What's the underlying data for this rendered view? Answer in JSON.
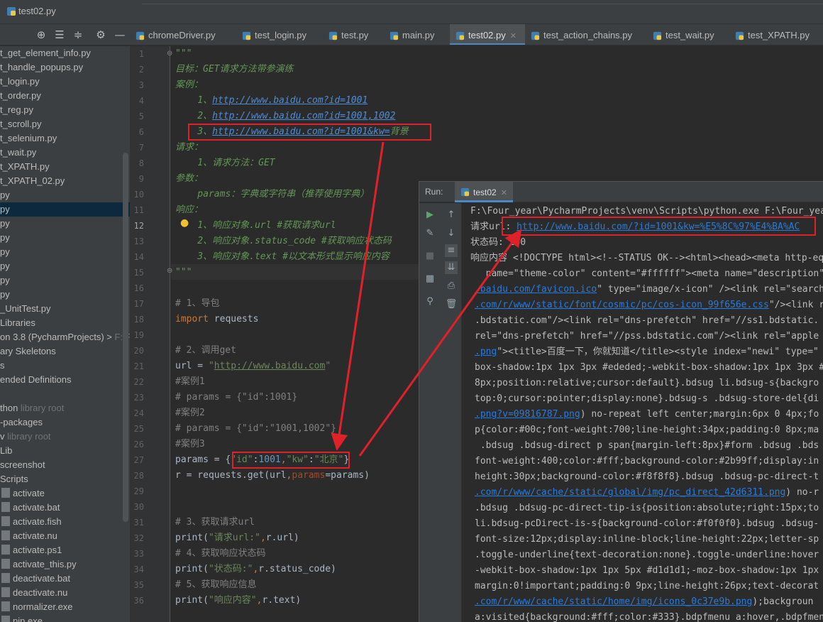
{
  "window": {
    "file_title": "test02.py"
  },
  "tabs": [
    {
      "label": "chromeDriver.py",
      "active": false
    },
    {
      "label": "test_login.py",
      "active": false
    },
    {
      "label": "test.py",
      "active": false
    },
    {
      "label": "main.py",
      "active": false
    },
    {
      "label": "test02.py",
      "active": true
    },
    {
      "label": "test_action_chains.py",
      "active": false
    },
    {
      "label": "test_wait.py",
      "active": false
    },
    {
      "label": "test_XPATH.py",
      "active": false
    }
  ],
  "project_tree": [
    {
      "label": "t_get_element_info.py",
      "muted": ""
    },
    {
      "label": "t_handle_popups.py",
      "muted": ""
    },
    {
      "label": "t_login.py",
      "muted": ""
    },
    {
      "label": "t_order.py",
      "muted": ""
    },
    {
      "label": "t_reg.py",
      "muted": ""
    },
    {
      "label": "t_scroll.py",
      "muted": ""
    },
    {
      "label": "t_selenium.py",
      "muted": ""
    },
    {
      "label": "t_wait.py",
      "muted": ""
    },
    {
      "label": "t_XPATH.py",
      "muted": ""
    },
    {
      "label": "t_XPATH_02.py",
      "muted": ""
    },
    {
      "label": "py",
      "muted": ""
    },
    {
      "label": "py",
      "muted": "",
      "selected": true
    },
    {
      "label": "py",
      "muted": ""
    },
    {
      "label": "py",
      "muted": ""
    },
    {
      "label": "py",
      "muted": ""
    },
    {
      "label": "py",
      "muted": ""
    },
    {
      "label": "py",
      "muted": ""
    },
    {
      "label": "py",
      "muted": ""
    },
    {
      "label": "_UnitTest.py",
      "muted": ""
    },
    {
      "label": "Libraries",
      "muted": ""
    },
    {
      "label": "on 3.8 (PycharmProjects)  > ",
      "muted": "F:\\F"
    },
    {
      "label": "ary Skeletons",
      "muted": ""
    },
    {
      "label": "s",
      "muted": ""
    },
    {
      "label": "ended Definitions",
      "muted": ""
    },
    {
      "label": "",
      "muted": ""
    },
    {
      "label": "thon ",
      "muted": "library root"
    },
    {
      "label": "-packages",
      "muted": ""
    },
    {
      "label": "v ",
      "muted": "library root"
    },
    {
      "label": "Lib",
      "muted": ""
    },
    {
      "label": "screenshot",
      "muted": ""
    },
    {
      "label": "Scripts",
      "muted": ""
    },
    {
      "label": "activate",
      "muted": ""
    },
    {
      "label": "activate.bat",
      "muted": ""
    },
    {
      "label": "activate.fish",
      "muted": ""
    },
    {
      "label": "activate.nu",
      "muted": ""
    },
    {
      "label": "activate.ps1",
      "muted": ""
    },
    {
      "label": "activate_this.py",
      "muted": ""
    },
    {
      "label": "deactivate.bat",
      "muted": ""
    },
    {
      "label": "deactivate.nu",
      "muted": ""
    },
    {
      "label": "normalizer.exe",
      "muted": ""
    },
    {
      "label": "pip.exe",
      "muted": ""
    }
  ],
  "line_numbers": [
    "1",
    "2",
    "3",
    "4",
    "5",
    "6",
    "7",
    "8",
    "9",
    "10",
    "11",
    "12",
    "13",
    "14",
    "15",
    "16",
    "17",
    "18",
    "19",
    "20",
    "21",
    "22",
    "23",
    "24",
    "25",
    "26",
    "27",
    "28",
    "29",
    "30",
    "31",
    "32",
    "33",
    "34",
    "35",
    "36"
  ],
  "code": {
    "l1": "\"\"\"",
    "l2": "目标：GET请求方法带参演练",
    "l3": "案例：",
    "l4_pre": "    1、",
    "l4_link": "http://www.baidu.com?id=1001",
    "l5_pre": "    2、",
    "l5_link": "http://www.baidu.com?id=1001,1002",
    "l6_pre": "    3、",
    "l6_link": "http://www.baidu.com?id=1001&kw=",
    "l6_post": "背景",
    "l7": "请求：",
    "l8": "    1、请求方法：GET",
    "l9": "参数：",
    "l10": "    params：字典或字符串（推荐使用字典）",
    "l11": "响应：",
    "l12": "    1、响应对象.url #获取请求url",
    "l13": "    2、响应对象.status_code #获取响应状态码",
    "l14": "    3、响应对象.text #以文本形式显示响应内容",
    "l15": "\"\"\"",
    "l17": "# 1、导包",
    "l18_kw": "import",
    "l18_rest": " requests",
    "l20": "# 2、调用get",
    "l21_a": "url = ",
    "l21_q": "\"",
    "l21_link": "http://www.baidu.com",
    "l21_q2": "\"",
    "l22": "#案例1",
    "l23": "# params = {\"id\":1001}",
    "l24": "#案例2",
    "l25": "# params = {\"id\":\"1001,1002\"}",
    "l26": "#案例3",
    "l27_a": "params = {",
    "l27_k1": "\"id\"",
    "l27_c1": ":",
    "l27_n": "1001",
    "l27_c2": ",",
    "l27_k2": "\"kw\"",
    "l27_c3": ":",
    "l27_v": "\"北京\"",
    "l27_b": "}",
    "l28_a": "r = requests.get(url",
    "l28_comma": ",",
    "l28_p": "params",
    "l28_b": "=params)",
    "l31": "# 3、获取请求url",
    "l32_a": "print(",
    "l32_s": "\"请求url:\"",
    "l32_c": ",",
    "l32_b": "r.url)",
    "l33": "# 4、获取响应状态码",
    "l34_a": "print(",
    "l34_s": "\"状态码:\"",
    "l34_c": ",",
    "l34_b": "r.status_code)",
    "l35": "# 5、获取响应信息",
    "l36_a": "print(",
    "l36_s": "\"响应内容\"",
    "l36_c": ",",
    "l36_b": "r.text)"
  },
  "run": {
    "label": "Run:",
    "tab": "test02",
    "lines": {
      "c1": "F:\\Four_year\\PycharmProjects\\venv\\Scripts\\python.exe F:\\Four_year",
      "c2_pre": "请求url: ",
      "c2_link": "http://www.baidu.com/?id=1001&kw=%E5%8C%97%E4%BA%AC",
      "c3": "状态码: 200",
      "c4": "响应内容 <!DOCTYPE html><!--STATUS OK--><html><head><meta http-eq",
      "c5": "  name=\"theme-color\" content=\"#ffffff\"><meta name=\"description\"",
      "c6_link": ".baidu.com/favicon.ico",
      "c6_rest": "\" type=\"image/x-icon\" /><link rel=\"search\"",
      "c7_link": ".com/r/www/static/font/cosmic/pc/cos-icon_99f656e.css",
      "c7_rest": "\"/><link r",
      "c8": ".bdstatic.com\"/><link rel=\"dns-prefetch\" href=\"//ss1.bdstatic.",
      "c9": "rel=\"dns-prefetch\" href=\"//pss.bdstatic.com\"/><link rel=\"apple",
      "c10_link": ".png",
      "c10_rest": "\"><title>百度一下，你就知道</title><style index=\"newi\" type=\"",
      "c11": "box-shadow:1px 1px 3px #ededed;-webkit-box-shadow:1px 1px 3px #",
      "c12": "8px;position:relative;cursor:default}.bdsug li.bdsug-s{backgro",
      "c13": "top:0;cursor:pointer;display:none}.bdsug-s .bdsug-store-del{di",
      "c14_link": ".png?v=09816787.png",
      "c14_rest": ") no-repeat left center;margin:6px 0 4px;fo",
      "c15": "p{color:#00c;font-weight:700;line-height:34px;padding:0 8px;ma",
      "c16": " .bdsug .bdsug-direct p span{margin-left:8px}#form .bdsug .bds",
      "c17": "font-weight:400;color:#fff;background-color:#2b99ff;display:in",
      "c18": "height:30px;background-color:#f8f8f8}.bdsug .bdsug-pc-direct-t",
      "c19_link": ".com/r/www/cache/static/global/img/pc_direct_42d6311.png",
      "c19_rest": ") no-r",
      "c20": ".bdsug .bdsug-pc-direct-tip-is{position:absolute;right:15px;to",
      "c21": "li.bdsug-pcDirect-is-s{background-color:#f0f0f0}.bdsug .bdsug-",
      "c22": "font-size:12px;display:inline-block;line-height:22px;letter-sp",
      "c23": ".toggle-underline{text-decoration:none}.toggle-underline:hover",
      "c24": "-webkit-box-shadow:1px 1px 5px #d1d1d1;-moz-box-shadow:1px 1px",
      "c25": "margin:0!important;padding:0 9px;line-height:26px;text-decorat",
      "c26_link": ".com/r/www/cache/static/home/img/icons_0c37e9b.png",
      "c26_rest": ");backgroun",
      "c27": "a:visited{background:#fff;color:#333}.bdpfmenu a:hover,.bdpfmen"
    }
  },
  "colors": {
    "accent": "#4a88c7",
    "annotation": "#e0212a",
    "link": "#287bde"
  }
}
